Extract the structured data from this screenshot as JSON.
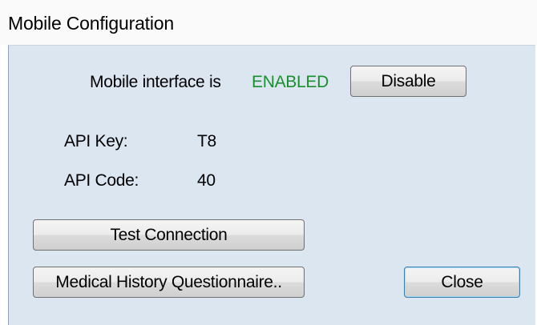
{
  "window": {
    "title": "Mobile Configuration"
  },
  "status_row": {
    "prefix": "Mobile interface is",
    "status": "ENABLED",
    "status_color": "#1a8f2f",
    "disable_label": "Disable"
  },
  "api": {
    "key_label": "API Key:",
    "key_value": "T8",
    "code_label": "API Code:",
    "code_value": "40"
  },
  "buttons": {
    "test_connection": "Test Connection",
    "medical_history": "Medical History Questionnaire..",
    "close": "Close"
  }
}
